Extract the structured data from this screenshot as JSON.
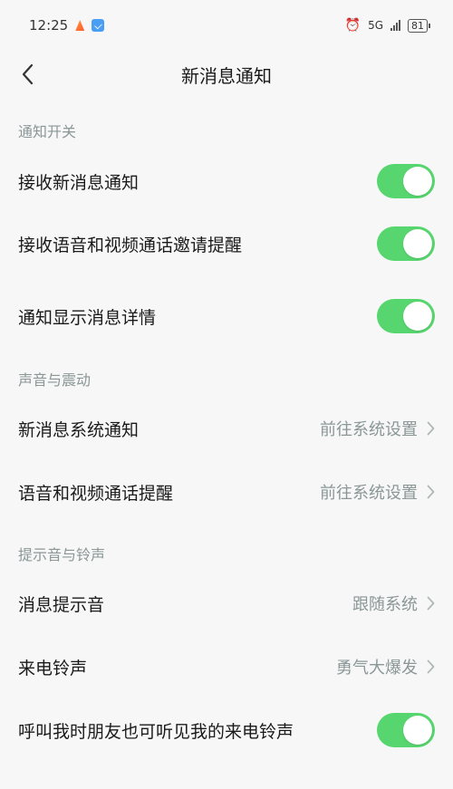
{
  "status_bar": {
    "time": "12:25",
    "network": "5G",
    "battery": "81"
  },
  "nav": {
    "title": "新消息通知"
  },
  "sections": [
    {
      "header": "通知开关",
      "rows": [
        {
          "label": "接收新消息通知",
          "toggle_on": true
        },
        {
          "label": "接收语音和视频通话邀请提醒",
          "toggle_on": true
        },
        {
          "label": "通知显示消息详情",
          "toggle_on": true
        }
      ]
    },
    {
      "header": "声音与震动",
      "rows": [
        {
          "label": "新消息系统通知",
          "value": "前往系统设置"
        },
        {
          "label": "语音和视频通话提醒",
          "value": "前往系统设置"
        }
      ]
    },
    {
      "header": "提示音与铃声",
      "rows": [
        {
          "label": "消息提示音",
          "value": "跟随系统"
        },
        {
          "label": "来电铃声",
          "value": "勇气大爆发"
        },
        {
          "label": "呼叫我时朋友也可听见我的来电铃声",
          "toggle_on": true
        }
      ]
    }
  ],
  "colors": {
    "toggle_on": "#57d66f",
    "section_header": "#8a9796",
    "background": "#f7f7f7"
  }
}
